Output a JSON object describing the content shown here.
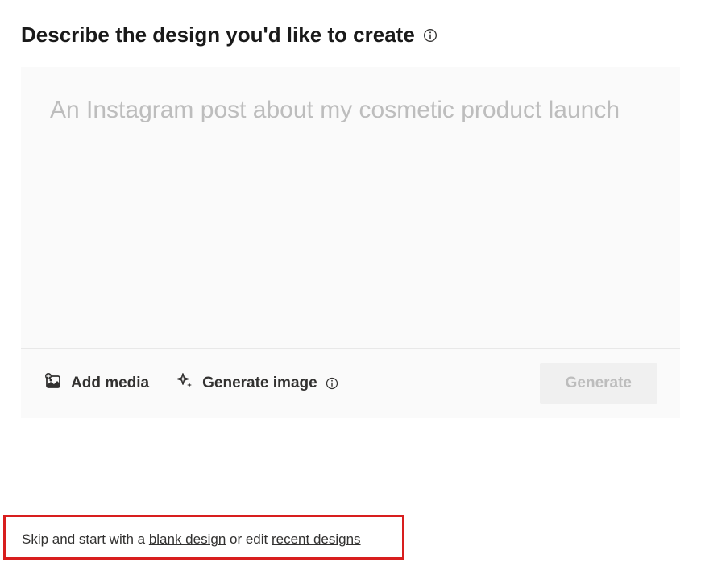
{
  "header": {
    "title": "Describe the design you'd like to create"
  },
  "prompt": {
    "placeholder": "An Instagram post about my cosmetic product launch",
    "value": ""
  },
  "toolbar": {
    "add_media_label": "Add media",
    "generate_image_label": "Generate image",
    "generate_label": "Generate"
  },
  "skip": {
    "prefix": "Skip and start with a ",
    "blank_link": "blank design",
    "middle": " or edit ",
    "recent_link": "recent designs"
  }
}
